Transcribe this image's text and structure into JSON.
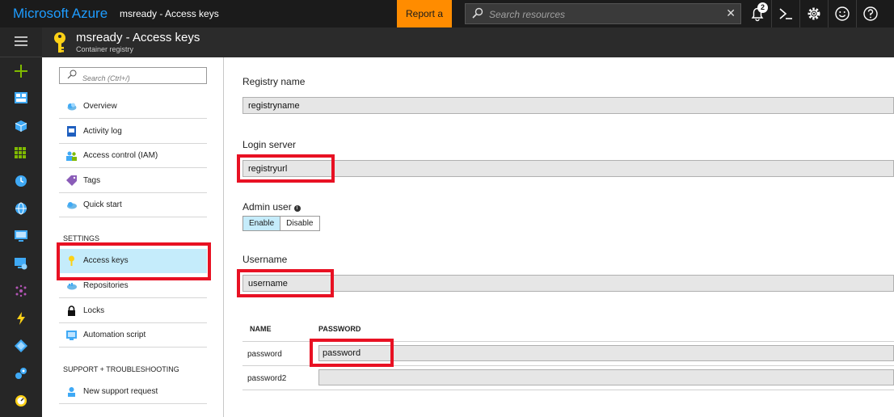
{
  "topbar": {
    "brand": "Microsoft Azure",
    "breadcrumb": "msready - Access keys",
    "report_bug": "Report a bug",
    "search_placeholder": "Search resources",
    "search_clear": "✕",
    "notification_count": "2"
  },
  "blade": {
    "title": "msready - Access keys",
    "subtitle": "Container registry"
  },
  "menu": {
    "search_placeholder": "Search (Ctrl+/)",
    "items": [
      {
        "label": "Overview"
      },
      {
        "label": "Activity log"
      },
      {
        "label": "Access control (IAM)"
      },
      {
        "label": "Tags"
      },
      {
        "label": "Quick start"
      }
    ],
    "settings_header": "SETTINGS",
    "settings_items": [
      {
        "label": "Access keys",
        "selected": true
      },
      {
        "label": "Repositories"
      },
      {
        "label": "Locks"
      },
      {
        "label": "Automation script"
      }
    ],
    "support_header": "SUPPORT + TROUBLESHOOTING",
    "support_items": [
      {
        "label": "New support request"
      }
    ]
  },
  "content": {
    "registry_name_label": "Registry name",
    "registry_name_value": "registryname",
    "login_server_label": "Login server",
    "login_server_value": "registryurl",
    "admin_user_label": "Admin user",
    "admin_user_info_icon": "info-icon",
    "admin_user_options": [
      "Enable",
      "Disable"
    ],
    "admin_user_selected": "Enable",
    "username_label": "Username",
    "username_value": "username",
    "password_table": {
      "columns": [
        "NAME",
        "PASSWORD"
      ],
      "rows": [
        {
          "name": "password",
          "value": "password"
        },
        {
          "name": "password2",
          "value": ""
        }
      ]
    }
  },
  "colors": {
    "accent": "#1e9cff",
    "report_bug_bg": "#ff8c00",
    "highlight_red": "#e81123",
    "selected_bg": "#c5ecfb"
  }
}
